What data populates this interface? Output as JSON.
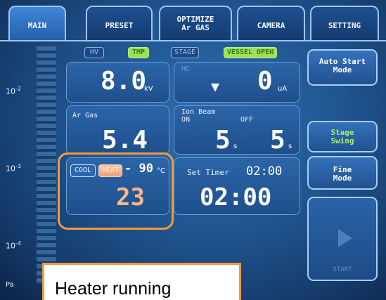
{
  "tabs": [
    {
      "label": "MAIN",
      "line2": ""
    },
    {
      "label": "PRESET",
      "line2": ""
    },
    {
      "label": "OPTIMIZE",
      "line2": "Ar GAS"
    },
    {
      "label": "CAMERA",
      "line2": ""
    },
    {
      "label": "SETTING",
      "line2": ""
    }
  ],
  "scale": {
    "labels": [
      {
        "base": "10",
        "exp": "-2"
      },
      {
        "base": "10",
        "exp": "-3"
      },
      {
        "base": "10",
        "exp": "-4"
      }
    ],
    "unit": "Pa"
  },
  "indicators": {
    "hv": "HV",
    "tmp": "TMP",
    "stage": "STAGE",
    "vessel_open": "VESSEL OPEN"
  },
  "hv_panel": {
    "value": "8.0",
    "unit": "kV"
  },
  "current_panel": {
    "label": "HC",
    "arrow": "▼",
    "value": "0",
    "unit": "uA"
  },
  "ar_gas_panel": {
    "label": "Ar Gas",
    "value": "5.4"
  },
  "ion_beam_panel": {
    "label": "Ion Beam",
    "on_label": "ON",
    "off_label": "OFF",
    "on_value": "5",
    "on_unit": "s",
    "off_value": "5",
    "off_unit": "s"
  },
  "temp_panel": {
    "cool_label": "COOL",
    "heat_label": "HEAT",
    "setpoint": "- 90",
    "setpoint_unit": "°C",
    "current": "23"
  },
  "timer_panel": {
    "label": "Set Timer",
    "set_value": "02:00",
    "value": "02:00"
  },
  "right_buttons": {
    "auto_start": "Auto Start\nMode",
    "stage_swing": "Stage\nSwing",
    "fine_mode": "Fine\nMode",
    "start": "START"
  },
  "annotation": {
    "caption": "Heater running"
  },
  "colors": {
    "accent_orange": "#f29a3a",
    "active_green": "#9be25a",
    "heat_orange": "#ffb48a"
  }
}
